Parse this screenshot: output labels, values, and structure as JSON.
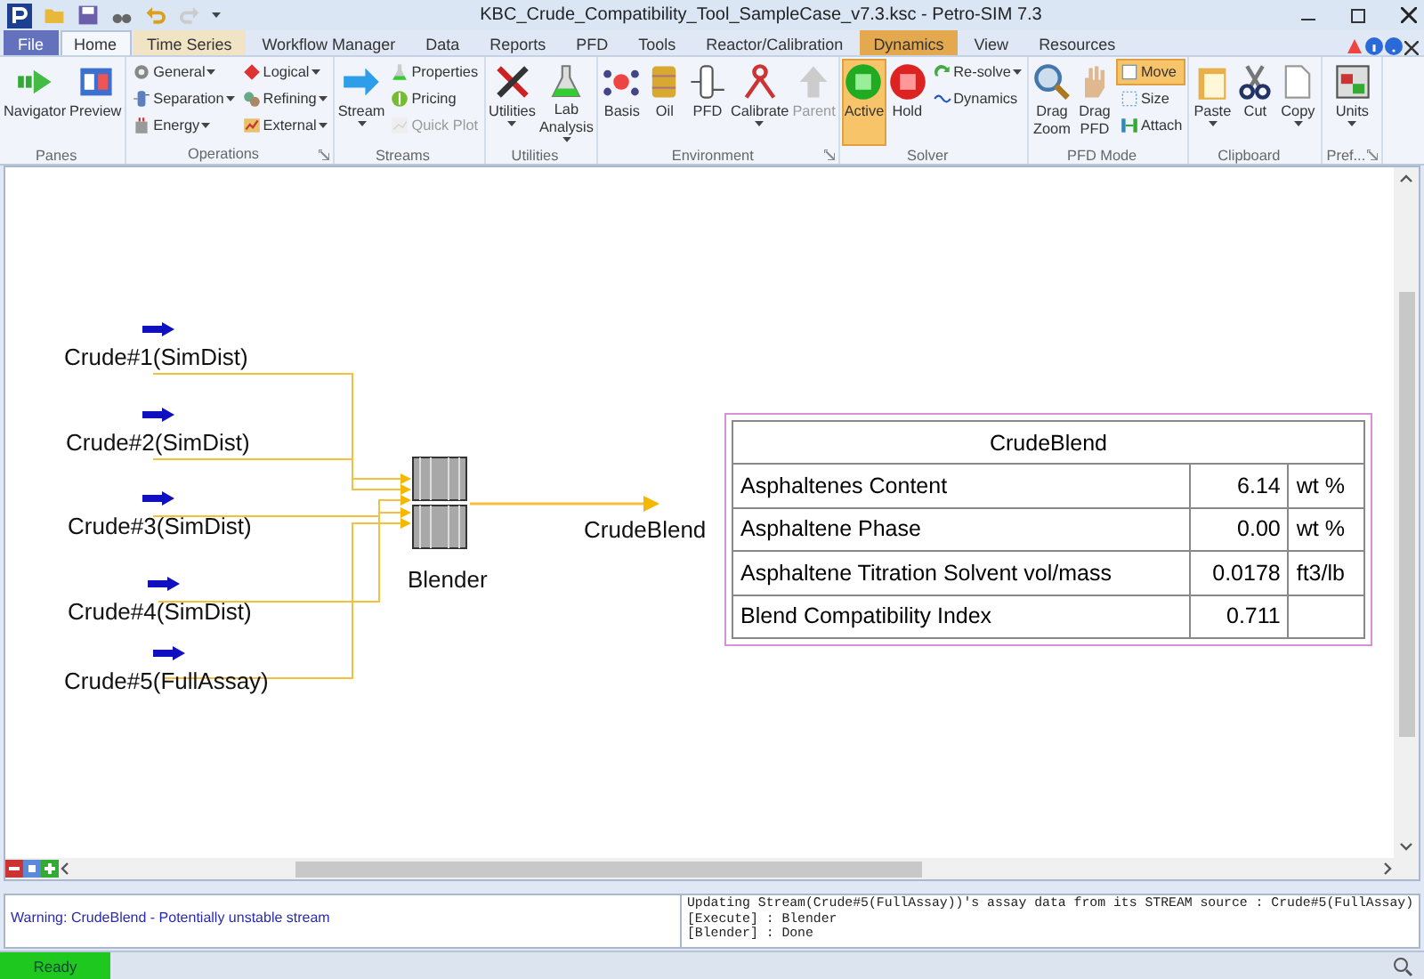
{
  "window": {
    "title": "KBC_Crude_Compatibility_Tool_SampleCase_v7.3.ksc - Petro-SIM 7.3"
  },
  "tabs": [
    {
      "label": "File",
      "kind": "file",
      "selected": false
    },
    {
      "label": "Home",
      "kind": "normal",
      "selected": true
    },
    {
      "label": "Time Series",
      "kind": "contextual",
      "color": "#f0e4c4",
      "selected": false
    },
    {
      "label": "Workflow Manager",
      "kind": "normal",
      "selected": false
    },
    {
      "label": "Data",
      "kind": "normal",
      "selected": false
    },
    {
      "label": "Reports",
      "kind": "normal",
      "selected": false
    },
    {
      "label": "PFD",
      "kind": "normal",
      "selected": false
    },
    {
      "label": "Tools",
      "kind": "normal",
      "selected": false
    },
    {
      "label": "Reactor/Calibration",
      "kind": "normal",
      "selected": false
    },
    {
      "label": "Dynamics",
      "kind": "contextual",
      "color": "#e4a94e",
      "selected": false
    },
    {
      "label": "View",
      "kind": "normal",
      "selected": false
    },
    {
      "label": "Resources",
      "kind": "normal",
      "selected": false
    }
  ],
  "ribbon": [
    {
      "label": "Panes",
      "items": [
        {
          "kind": "large",
          "label": "Navigator"
        },
        {
          "kind": "large",
          "label": "Preview"
        }
      ]
    },
    {
      "label": "Operations",
      "launcher": true,
      "items": [
        {
          "kind": "small",
          "label": "General",
          "dropdown": true
        },
        {
          "kind": "small",
          "label": "Separation",
          "dropdown": true
        },
        {
          "kind": "small",
          "label": "Energy",
          "dropdown": true
        },
        {
          "kind": "small",
          "label": "Logical",
          "dropdown": true
        },
        {
          "kind": "small",
          "label": "Refining",
          "dropdown": true
        },
        {
          "kind": "small",
          "label": "External",
          "dropdown": true
        }
      ]
    },
    {
      "label": "Streams",
      "items": [
        {
          "kind": "large",
          "label": "Stream",
          "dropdown": true
        },
        {
          "kind": "small",
          "label": "Properties"
        },
        {
          "kind": "small",
          "label": "Pricing"
        },
        {
          "kind": "small",
          "label": "Quick Plot",
          "disabled": true
        }
      ]
    },
    {
      "label": "Utilities",
      "items": [
        {
          "kind": "large",
          "label": "Utilities",
          "dropdown": true
        },
        {
          "kind": "large",
          "label": "Lab Analysis",
          "dropdown": true
        }
      ]
    },
    {
      "label": "Environment",
      "launcher": true,
      "items": [
        {
          "kind": "large",
          "label": "Basis"
        },
        {
          "kind": "large",
          "label": "Oil"
        },
        {
          "kind": "large",
          "label": "PFD"
        },
        {
          "kind": "large",
          "label": "Calibrate",
          "dropdown": true
        },
        {
          "kind": "large",
          "label": "Parent",
          "disabled": true
        }
      ]
    },
    {
      "label": "Solver",
      "items": [
        {
          "kind": "large",
          "label": "Active",
          "selected": true
        },
        {
          "kind": "large",
          "label": "Hold",
          "selected": false
        },
        {
          "kind": "small",
          "label": "Re-solve",
          "dropdown": true
        },
        {
          "kind": "small",
          "label": "Dynamics"
        }
      ]
    },
    {
      "label": "PFD Mode",
      "items": [
        {
          "kind": "large",
          "label": "Drag Zoom",
          "selected": false
        },
        {
          "kind": "large",
          "label": "Drag PFD",
          "selected": false
        },
        {
          "kind": "small",
          "label": "Move",
          "selected": true
        },
        {
          "kind": "small",
          "label": "Size",
          "selected": false
        },
        {
          "kind": "small",
          "label": "Attach",
          "selected": false
        }
      ]
    },
    {
      "label": "Clipboard",
      "items": [
        {
          "kind": "large",
          "label": "Paste",
          "dropdown": true
        },
        {
          "kind": "large",
          "label": "Cut"
        },
        {
          "kind": "large",
          "label": "Copy",
          "dropdown": true
        }
      ]
    },
    {
      "label": "Pref...",
      "launcher": true,
      "items": [
        {
          "kind": "large",
          "label": "Units",
          "dropdown": true
        }
      ]
    }
  ],
  "pfd": {
    "feeds": [
      "Crude#1(SimDist)",
      "Crude#2(SimDist)",
      "Crude#3(SimDist)",
      "Crude#4(SimDist)",
      "Crude#5(FullAssay)"
    ],
    "unit": "Blender",
    "product": "CrudeBlend",
    "table": {
      "title": "CrudeBlend",
      "rows": [
        {
          "name": "Asphaltenes Content",
          "value": "6.14",
          "unit": "wt %"
        },
        {
          "name": "Asphaltene Phase",
          "value": "0.00",
          "unit": "wt %"
        },
        {
          "name": "Asphaltene Titration Solvent vol/mass",
          "value": "0.0178",
          "unit": "ft3/lb"
        },
        {
          "name": "Blend Compatibility Index",
          "value": "0.711"
        }
      ]
    }
  },
  "messages": {
    "warning": "Warning:  CrudeBlend - Potentially unstable stream",
    "trace": [
      "Updating Stream(Crude#5(FullAssay))'s assay data from its STREAM source : Crude#5(FullAssay)",
      "[Execute] : Blender",
      "[Blender] : Done"
    ]
  },
  "status_bar": {
    "text": "Ready"
  }
}
